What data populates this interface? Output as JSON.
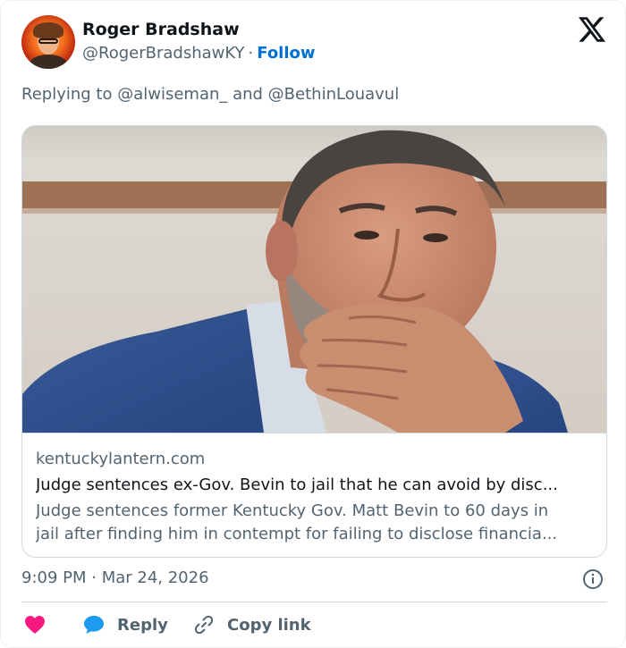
{
  "author": {
    "display_name": "Roger Bradshaw",
    "handle": "@RogerBradshawKY",
    "separator": "·",
    "follow_label": "Follow"
  },
  "reply_context": {
    "text": "Replying to @alwiseman_ and @BethinLouavul"
  },
  "link_card": {
    "domain": "kentuckylantern.com",
    "title": "Judge sentences ex-Gov. Bevin to jail that he can avoid by disc...",
    "description_line_1": "Judge sentences former Kentucky Gov. Matt Bevin to 60 days in",
    "description_line_2": "jail after finding him in contempt for failing to disclose financia..."
  },
  "meta": {
    "timestamp": "9:09 PM · Mar 24, 2026"
  },
  "actions": {
    "reply_label": "Reply",
    "copy_link_label": "Copy link"
  },
  "icons": {
    "brand": "x-logo-icon",
    "info": "info-icon",
    "like": "heart-icon",
    "reply": "speech-bubble-icon",
    "copy": "link-icon"
  },
  "colors": {
    "follow": "#006fd6",
    "like": "#f91880",
    "reply": "#1d9bf0",
    "secondary_text": "#536471",
    "primary_text": "#0f1419"
  }
}
